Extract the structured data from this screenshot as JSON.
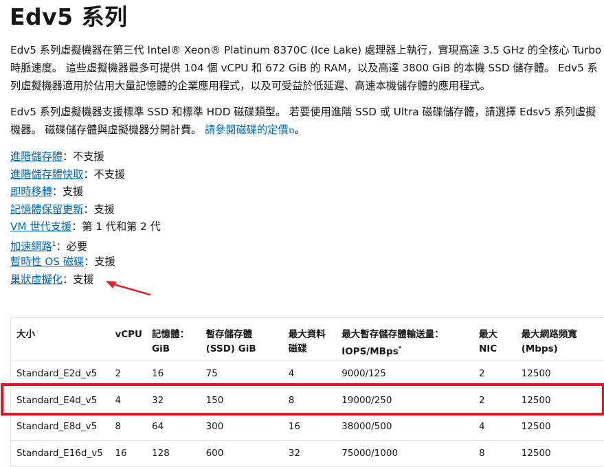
{
  "page": {
    "title": "Edv5 系列",
    "intro": "Edv5 系列虛擬機器在第三代 Intel® Xeon® Platinum 8370C (Ice Lake) 處理器上執行，實現高達 3.5 GHz 的全核心 Turbo 時脈速度。 這些虛擬機器最多可提供 104 個 vCPU 和 672 GiB 的 RAM，以及高達 3800 GiB 的本機 SSD 儲存體。 Edv5 系列虛擬機器適用於佔用大量記憶體的企業應用程式，以及可受益於低延遲、高速本機儲存體的應用程式。",
    "disk_text": "Edv5 系列虛擬機器支援標準 SSD 和標準 HDD 磁碟類型。 若要使用進階 SSD 或 Ultra 磁碟儲存體，請選擇 Edsv5 系列虛擬機器。 磁碟儲存體與虛擬機器分開計費。 ",
    "pricing_link": "請參閱磁碟的定價",
    "pricing_link_after": "。"
  },
  "features": [
    {
      "label": "進階儲存體",
      "value": "不支援"
    },
    {
      "label": "進階儲存體快取",
      "value": "不支援"
    },
    {
      "label": "即時移轉",
      "value": "支援"
    },
    {
      "label": "記憶體保留更新",
      "value": "支援"
    },
    {
      "label": "VM 世代支援",
      "value": "第 1 代和第 2 代"
    },
    {
      "label": "加速網路",
      "value": "必要",
      "footnote": "1"
    },
    {
      "label": "暫時性 OS 磁碟",
      "value": "支援"
    },
    {
      "label": "巢狀虛擬化",
      "value": "支援"
    }
  ],
  "separator": "：",
  "table": {
    "headers": [
      [
        "大小",
        ""
      ],
      [
        "vCPU",
        ""
      ],
      [
        "記憶體：",
        "GiB"
      ],
      [
        "暫存儲存體",
        "(SSD) GiB"
      ],
      [
        "最大資料",
        "磁碟"
      ],
      [
        "最大暫存儲存體輸送量：",
        "IOPS/MBps"
      ],
      [
        "最大",
        "NIC"
      ],
      [
        "最大網路頻寬",
        "(Mbps)"
      ]
    ],
    "header_footnote": "*",
    "rows": [
      [
        "Standard_E2d_v5",
        "2",
        "16",
        "75",
        "4",
        "9000/125",
        "2",
        "12500"
      ],
      [
        "Standard_E4d_v5",
        "4",
        "32",
        "150",
        "8",
        "19000/250",
        "2",
        "12500"
      ],
      [
        "Standard_E8d_v5",
        "8",
        "64",
        "300",
        "16",
        "38000/500",
        "4",
        "12500"
      ],
      [
        "Standard_E16d_v5",
        "16",
        "128",
        "600",
        "32",
        "75000/1000",
        "8",
        "12500"
      ]
    ]
  },
  "annotations": {
    "arrow_color": "#d9252b",
    "highlight_color": "#e81123",
    "highlighted_row": "Standard_E4d_v5"
  }
}
